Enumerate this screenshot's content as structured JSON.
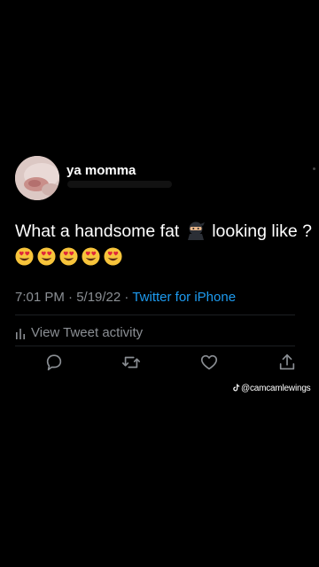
{
  "tweet": {
    "display_name": "ya momma",
    "text_before": "What a handsome fat",
    "text_after": "looking like ?",
    "emojis": [
      "heart-eyes-emoji",
      "heart-eyes-emoji",
      "heart-eyes-emoji",
      "heart-eyes-emoji",
      "heart-eyes-emoji"
    ],
    "time": "7:01 PM · 5/19/22 · ",
    "source": "Twitter for iPhone",
    "activity_label": "View Tweet activity"
  },
  "actions": [
    "reply-icon",
    "retweet-icon",
    "like-icon",
    "share-icon"
  ],
  "watermark": {
    "handle": "@camcamlewings"
  },
  "colors": {
    "background": "#000000",
    "text": "#ffffff",
    "muted": "#8b8f94",
    "link": "#1d9bf0"
  }
}
